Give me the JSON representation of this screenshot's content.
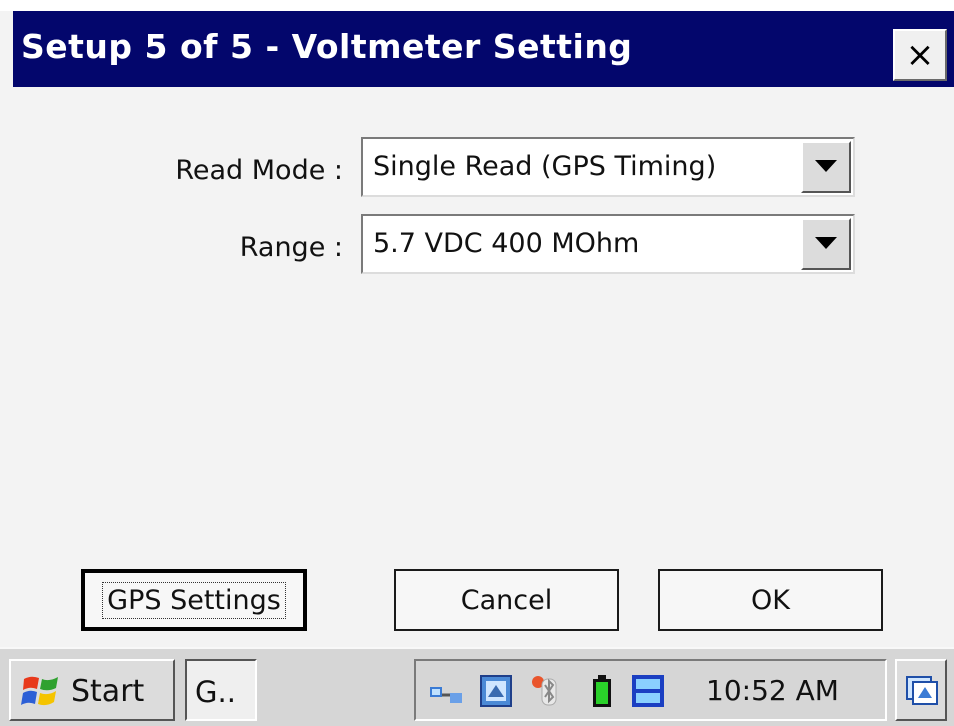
{
  "window": {
    "title": "Setup 5 of 5 - Voltmeter Setting",
    "close_label": "×"
  },
  "form": {
    "read_mode_label": "Read Mode :",
    "read_mode_value": "Single Read (GPS Timing)",
    "range_label": "Range :",
    "range_value": "5.7 VDC 400 MOhm"
  },
  "buttons": {
    "gps_settings": "GPS Settings",
    "cancel": "Cancel",
    "ok": "OK"
  },
  "taskbar": {
    "start_label": "Start",
    "task_label": "G..",
    "clock": "10:52 AM",
    "tray_icons": [
      "network-icon",
      "app-icon",
      "bluetooth-icon",
      "battery-icon",
      "dtg-client-icon"
    ],
    "desktop_icon": "show-desktop-icon"
  },
  "colors": {
    "titlebar": "#03066c",
    "window_bg": "#f3f3f3",
    "taskbar_bg": "#d6d6d6"
  }
}
